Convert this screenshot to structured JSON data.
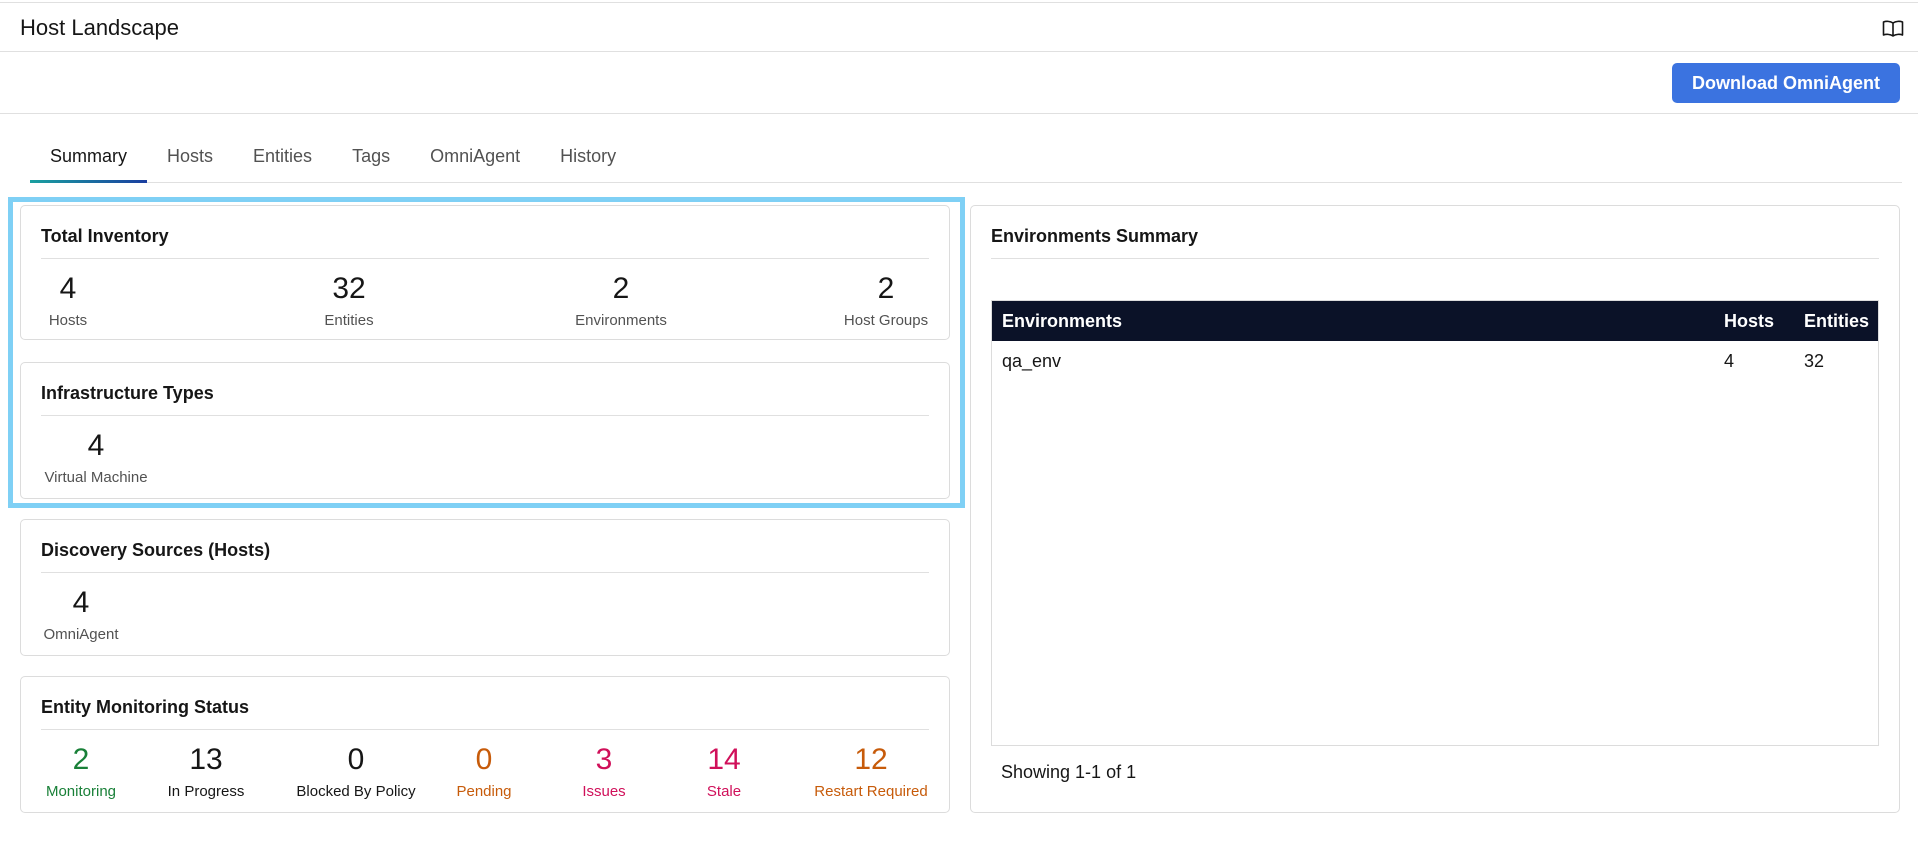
{
  "header": {
    "title": "Host Landscape",
    "docs_icon": "book-open-icon"
  },
  "actions": {
    "download_label": "Download OmniAgent",
    "accent": "#3b73e0"
  },
  "tabs": [
    {
      "label": "Summary",
      "active": true
    },
    {
      "label": "Hosts",
      "active": false
    },
    {
      "label": "Entities",
      "active": false
    },
    {
      "label": "Tags",
      "active": false
    },
    {
      "label": "OmniAgent",
      "active": false
    },
    {
      "label": "History",
      "active": false
    }
  ],
  "total_inventory": {
    "title": "Total Inventory",
    "stats": [
      {
        "value": "4",
        "label": "Hosts"
      },
      {
        "value": "32",
        "label": "Entities"
      },
      {
        "value": "2",
        "label": "Environments"
      },
      {
        "value": "2",
        "label": "Host Groups"
      }
    ]
  },
  "infrastructure_types": {
    "title": "Infrastructure Types",
    "stats": [
      {
        "value": "4",
        "label": "Virtual Machine"
      }
    ]
  },
  "discovery_sources": {
    "title": "Discovery Sources (Hosts)",
    "stats": [
      {
        "value": "4",
        "label": "OmniAgent"
      }
    ]
  },
  "entity_monitoring": {
    "title": "Entity Monitoring Status",
    "stats": [
      {
        "value": "2",
        "label": "Monitoring",
        "color": "#198038"
      },
      {
        "value": "13",
        "label": "In Progress",
        "color": "#161616"
      },
      {
        "value": "0",
        "label": "Blocked By Policy",
        "color": "#161616"
      },
      {
        "value": "0",
        "label": "Pending",
        "color": "#c75b0a"
      },
      {
        "value": "3",
        "label": "Issues",
        "color": "#d0105a"
      },
      {
        "value": "14",
        "label": "Stale",
        "color": "#d0105a"
      },
      {
        "value": "12",
        "label": "Restart Required",
        "color": "#c75b0a"
      }
    ]
  },
  "environments_summary": {
    "title": "Environments Summary",
    "columns": {
      "env": "Environments",
      "hosts": "Hosts",
      "entities": "Entities"
    },
    "rows": [
      {
        "env": "qa_env",
        "hosts": "4",
        "entities": "32"
      }
    ],
    "footer": "Showing 1-1 of 1"
  },
  "colors": {
    "highlight": "#7fd0f5",
    "table_header": "#0b1228"
  }
}
